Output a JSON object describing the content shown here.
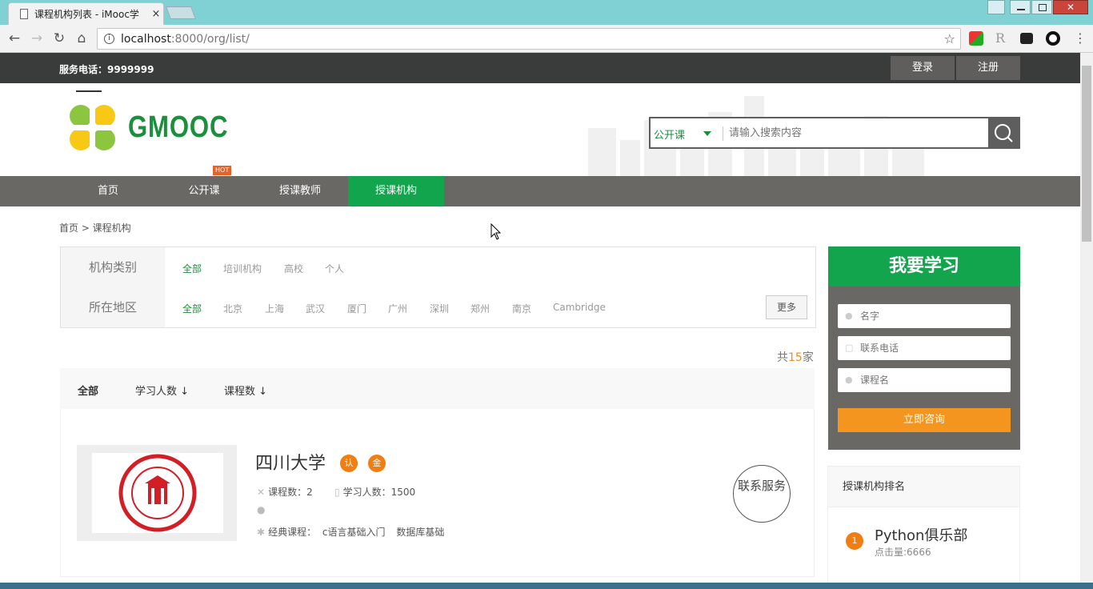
{
  "browser": {
    "tab_title": "课程机构列表 - iMooc学",
    "tab_close": "×",
    "url_host": "localhost",
    "url_rest": ":8000/org/list/"
  },
  "topbar": {
    "phone_label": "服务电话：9999999",
    "login": "登录",
    "register": "注册"
  },
  "header": {
    "logo_text": "GMOOC",
    "search_category": "公开课",
    "search_placeholder": "请输入搜索内容"
  },
  "nav": {
    "items": [
      "首页",
      "公开课",
      "授课教师",
      "授课机构"
    ],
    "hot_badge": "HOT",
    "active": "授课机构"
  },
  "breadcrumb": "首页 > 课程机构",
  "filters": {
    "category_label": "机构类别",
    "category_options": [
      "全部",
      "培训机构",
      "高校",
      "个人"
    ],
    "region_label": "所在地区",
    "region_options": [
      "全部",
      "北京",
      "上海",
      "武汉",
      "厦门",
      "广州",
      "深圳",
      "郑州",
      "南京",
      "Cambridge"
    ],
    "more": "更多"
  },
  "count": {
    "prefix": "共",
    "number": "15",
    "suffix": "家"
  },
  "sort": {
    "all": "全部",
    "by_students": "学习人数 ↓",
    "by_courses": "课程数 ↓"
  },
  "orgs": [
    {
      "name": "四川大学",
      "badge_cert": "认",
      "badge_gold": "金",
      "course_count": "课程数：2",
      "student_count": "学习人数：1500",
      "classic_label": "经典课程：",
      "classic_courses": [
        "c语言基础入门",
        "数据库基础"
      ],
      "contact": "联系服务"
    }
  ],
  "learn_form": {
    "title": "我要学习",
    "name_placeholder": "名字",
    "phone_placeholder": "联系电话",
    "course_placeholder": "课程名",
    "submit": "立即咨询"
  },
  "ranking": {
    "title": "授课机构排名",
    "items": [
      {
        "rank": "1",
        "name": "Python俱乐部",
        "hits": "点击量:6666"
      }
    ]
  },
  "colors": {
    "brand_green": "#13a54e",
    "accent_orange": "#f3951f",
    "nav_gray": "#6a6864",
    "dark_bar": "#3a3c3b"
  }
}
